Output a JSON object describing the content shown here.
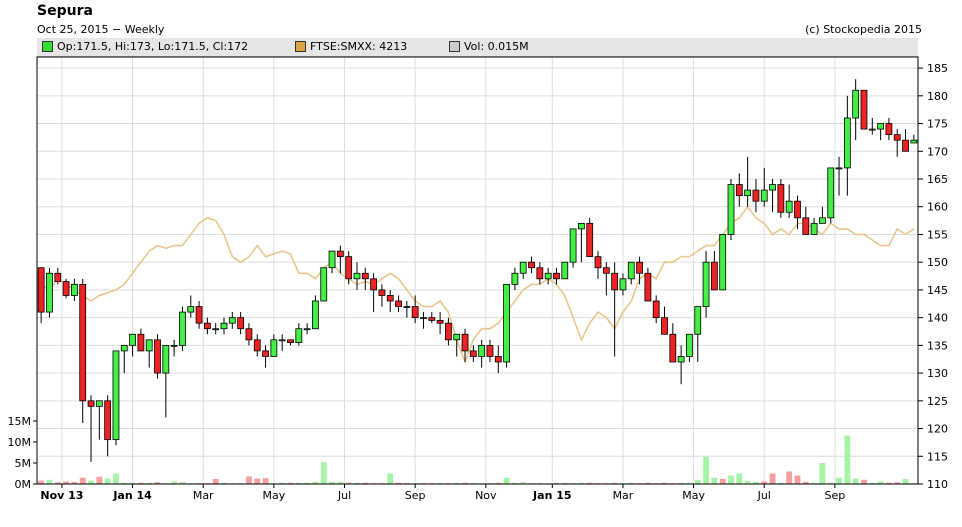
{
  "header": {
    "title": "Sepura",
    "subtitle": "Oct 25, 2015 − Weekly",
    "credit": "(c) Stockopedia 2015"
  },
  "legend": [
    {
      "text": "Op:171.5, Hi:173, Lo:171.5, Cl:172",
      "color": "#33dd33"
    },
    {
      "text": "FTSE:SMXX: 4213",
      "color": "#d9a441"
    },
    {
      "text": "Vol: 0.015M",
      "color": "#cccccc"
    }
  ],
  "colors": {
    "up": "#44ee44",
    "down": "#ee2222",
    "ftse": "#e8c68c",
    "vol_up": "#a6f5a6",
    "vol_down": "#f5a0a0",
    "grid": "#dddddd"
  },
  "chart_data": {
    "type": "candlestick",
    "title": "Sepura",
    "price_axis": {
      "side": "right",
      "ylim": [
        110,
        187
      ],
      "ticks": [
        110,
        115,
        120,
        125,
        130,
        135,
        140,
        145,
        150,
        155,
        160,
        165,
        170,
        175,
        180,
        185
      ]
    },
    "volume_axis": {
      "side": "left",
      "ylim": [
        0,
        20
      ],
      "unit": "M",
      "ticks": [
        {
          "v": 0,
          "label": "0M"
        },
        {
          "v": 5,
          "label": "5M"
        },
        {
          "v": 10,
          "label": "10M"
        },
        {
          "v": 15,
          "label": "15M"
        }
      ]
    },
    "x_labels": [
      {
        "i": 2.5,
        "label": "Nov 13",
        "bold": true
      },
      {
        "i": 11,
        "label": "Jan 14",
        "bold": true
      },
      {
        "i": 19.5,
        "label": "Mar",
        "bold": false
      },
      {
        "i": 28,
        "label": "May",
        "bold": false
      },
      {
        "i": 36.5,
        "label": "Jul",
        "bold": false
      },
      {
        "i": 45,
        "label": "Sep",
        "bold": false
      },
      {
        "i": 53.5,
        "label": "Nov",
        "bold": false
      },
      {
        "i": 61.5,
        "label": "Jan 15",
        "bold": true
      },
      {
        "i": 70,
        "label": "Mar",
        "bold": false
      },
      {
        "i": 78.5,
        "label": "May",
        "bold": false
      },
      {
        "i": 87,
        "label": "Jul",
        "bold": false
      },
      {
        "i": 95.5,
        "label": "Sep",
        "bold": false
      }
    ],
    "ohlc": [
      [
        149,
        149,
        139,
        141
      ],
      [
        141,
        149,
        140,
        148
      ],
      [
        148,
        149,
        146,
        146.5
      ],
      [
        146.5,
        147,
        143.5,
        144
      ],
      [
        144,
        147,
        143,
        146
      ],
      [
        146,
        147,
        121,
        125
      ],
      [
        125,
        126,
        114,
        124
      ],
      [
        124,
        125,
        118,
        125
      ],
      [
        125,
        126,
        115,
        118
      ],
      [
        118,
        134,
        117,
        134
      ],
      [
        134,
        135,
        130,
        135
      ],
      [
        135,
        137,
        133,
        137
      ],
      [
        137,
        138,
        134,
        134
      ],
      [
        134,
        136,
        131,
        136
      ],
      [
        136,
        137,
        129,
        130
      ],
      [
        130,
        135,
        122,
        135
      ],
      [
        135,
        136,
        133,
        135
      ],
      [
        135,
        142,
        134,
        141
      ],
      [
        141,
        144,
        140,
        142
      ],
      [
        142,
        143,
        138,
        139
      ],
      [
        139,
        140,
        137,
        138
      ],
      [
        138,
        139,
        137,
        138
      ],
      [
        138,
        140,
        137,
        139
      ],
      [
        139,
        141,
        138,
        140
      ],
      [
        140,
        141,
        137,
        138
      ],
      [
        138,
        139,
        135,
        136
      ],
      [
        136,
        137,
        133,
        134
      ],
      [
        134,
        135,
        131,
        133
      ],
      [
        133,
        137,
        133,
        136
      ],
      [
        136,
        137,
        134,
        136
      ],
      [
        136,
        136,
        135,
        135.5
      ],
      [
        135.5,
        139,
        135,
        138
      ],
      [
        138,
        139,
        137,
        138
      ],
      [
        138,
        144,
        138,
        143
      ],
      [
        143,
        148,
        143,
        149
      ],
      [
        149,
        150,
        148,
        152
      ],
      [
        152,
        153,
        148,
        151
      ],
      [
        151,
        152,
        146,
        147
      ],
      [
        147,
        150,
        145,
        148
      ],
      [
        148,
        149,
        145,
        147
      ],
      [
        147,
        148,
        141,
        145
      ],
      [
        145,
        146,
        142,
        144
      ],
      [
        144,
        145,
        141,
        143
      ],
      [
        143,
        144,
        141,
        142
      ],
      [
        142,
        143,
        140,
        142
      ],
      [
        142,
        144,
        139,
        140
      ],
      [
        140,
        141,
        138,
        140
      ],
      [
        140,
        141,
        139,
        139.5
      ],
      [
        139.5,
        141,
        137,
        139
      ],
      [
        139,
        140,
        135,
        136
      ],
      [
        136,
        137,
        133,
        137
      ],
      [
        137,
        138,
        132,
        134
      ],
      [
        134,
        135,
        132,
        133
      ],
      [
        133,
        136,
        131,
        135
      ],
      [
        135,
        136,
        132,
        133
      ],
      [
        133,
        135,
        130,
        132
      ],
      [
        132,
        146,
        131,
        146
      ],
      [
        146,
        149,
        145,
        148
      ],
      [
        148,
        150,
        147,
        150
      ],
      [
        150,
        151,
        148,
        149
      ],
      [
        149,
        150,
        146,
        147
      ],
      [
        147,
        149,
        146,
        148
      ],
      [
        148,
        149,
        146,
        147
      ],
      [
        147,
        150,
        147,
        150
      ],
      [
        150,
        156,
        149,
        156
      ],
      [
        156,
        157,
        150,
        157
      ],
      [
        157,
        158,
        151,
        151
      ],
      [
        151,
        152,
        147,
        149
      ],
      [
        149,
        150,
        144,
        148
      ],
      [
        148,
        150,
        133,
        145
      ],
      [
        145,
        148,
        144,
        147
      ],
      [
        147,
        149,
        146,
        150
      ],
      [
        150,
        151,
        146,
        148
      ],
      [
        148,
        149,
        143,
        143
      ],
      [
        143,
        144,
        139,
        140
      ],
      [
        140,
        142,
        137,
        137
      ],
      [
        137,
        139,
        134,
        132
      ],
      [
        132,
        135,
        128,
        133
      ],
      [
        133,
        137,
        132,
        137
      ],
      [
        137,
        142,
        132,
        142
      ],
      [
        142,
        152,
        140,
        150
      ],
      [
        150,
        152,
        146,
        145
      ],
      [
        145,
        153,
        145,
        155
      ],
      [
        155,
        165,
        154,
        164
      ],
      [
        164,
        166,
        160,
        162
      ],
      [
        162,
        169,
        160,
        163
      ],
      [
        163,
        165,
        159,
        161
      ],
      [
        161,
        167,
        160,
        163
      ],
      [
        163,
        165,
        159,
        164
      ],
      [
        164,
        165,
        158,
        159
      ],
      [
        159,
        164,
        158,
        161
      ],
      [
        161,
        162,
        156,
        158
      ],
      [
        158,
        160,
        155,
        155
      ],
      [
        155,
        158,
        155,
        157
      ],
      [
        157,
        160,
        157,
        158
      ],
      [
        158,
        167,
        157,
        167
      ],
      [
        167,
        169,
        162,
        167
      ],
      [
        167,
        180,
        162,
        176
      ],
      [
        176,
        183,
        172,
        181
      ],
      [
        181,
        181,
        174,
        174
      ],
      [
        174,
        176,
        173,
        174
      ],
      [
        174,
        175,
        172,
        175
      ],
      [
        175,
        176,
        172,
        173
      ],
      [
        173,
        174,
        169,
        172
      ],
      [
        172,
        174,
        170,
        170
      ],
      [
        171.5,
        173,
        171.5,
        172
      ]
    ],
    "volume_m": [
      [
        0.8,
        0
      ],
      [
        1.0,
        1
      ],
      [
        0.4,
        0
      ],
      [
        0.6,
        0
      ],
      [
        0.5,
        0
      ],
      [
        1.5,
        0
      ],
      [
        0.8,
        1
      ],
      [
        1.7,
        0
      ],
      [
        1.3,
        1
      ],
      [
        2.5,
        1
      ],
      [
        0.3,
        1
      ],
      [
        0.3,
        1
      ],
      [
        0.3,
        0
      ],
      [
        0.3,
        1
      ],
      [
        0.4,
        0
      ],
      [
        0.2,
        1
      ],
      [
        0.6,
        1
      ],
      [
        0.5,
        1
      ],
      [
        0.2,
        1
      ],
      [
        0.2,
        0
      ],
      [
        0.2,
        0
      ],
      [
        1.2,
        0
      ],
      [
        0.3,
        1
      ],
      [
        0.2,
        1
      ],
      [
        0.2,
        1
      ],
      [
        1.8,
        0
      ],
      [
        1.3,
        0
      ],
      [
        1.4,
        0
      ],
      [
        0.2,
        1
      ],
      [
        0.3,
        1
      ],
      [
        0.3,
        0
      ],
      [
        0.3,
        1
      ],
      [
        0.3,
        1
      ],
      [
        0.5,
        1
      ],
      [
        5.2,
        1
      ],
      [
        0.5,
        1
      ],
      [
        0.5,
        1
      ],
      [
        0.3,
        0
      ],
      [
        0.3,
        1
      ],
      [
        0.3,
        0
      ],
      [
        0.2,
        0
      ],
      [
        0.2,
        0
      ],
      [
        2.5,
        1
      ],
      [
        0.3,
        0
      ],
      [
        0.2,
        0
      ],
      [
        0.2,
        1
      ],
      [
        0.2,
        0
      ],
      [
        0.2,
        0
      ],
      [
        0.2,
        1
      ],
      [
        0.2,
        0
      ],
      [
        0.3,
        1
      ],
      [
        0.3,
        0
      ],
      [
        0.2,
        0
      ],
      [
        0.2,
        1
      ],
      [
        0.2,
        0
      ],
      [
        0.3,
        0
      ],
      [
        1.5,
        1
      ],
      [
        0.3,
        1
      ],
      [
        0.4,
        1
      ],
      [
        0.2,
        1
      ],
      [
        0.2,
        0
      ],
      [
        0.2,
        1
      ],
      [
        0.3,
        0
      ],
      [
        0.3,
        1
      ],
      [
        0.2,
        1
      ],
      [
        0.3,
        1
      ],
      [
        0.3,
        0
      ],
      [
        0.2,
        0
      ],
      [
        0.2,
        0
      ],
      [
        0.3,
        0
      ],
      [
        0.2,
        1
      ],
      [
        0.3,
        1
      ],
      [
        0.2,
        0
      ],
      [
        0.3,
        0
      ],
      [
        0.2,
        0
      ],
      [
        0.3,
        0
      ],
      [
        0.2,
        0
      ],
      [
        0.3,
        1
      ],
      [
        0.3,
        1
      ],
      [
        1.0,
        1
      ],
      [
        6.5,
        1
      ],
      [
        1.5,
        1
      ],
      [
        1.2,
        0
      ],
      [
        2.0,
        1
      ],
      [
        2.5,
        1
      ],
      [
        0.7,
        1
      ],
      [
        0.5,
        1
      ],
      [
        0.6,
        0
      ],
      [
        2.5,
        0
      ],
      [
        0.3,
        1
      ],
      [
        3.0,
        0
      ],
      [
        2.0,
        0
      ],
      [
        0.5,
        0
      ],
      [
        0.3,
        1
      ],
      [
        5.0,
        1
      ],
      [
        0.3,
        1
      ],
      [
        1.5,
        1
      ],
      [
        11.5,
        1
      ],
      [
        1.3,
        1
      ],
      [
        1.0,
        0
      ],
      [
        0.3,
        1
      ],
      [
        0.6,
        1
      ],
      [
        0.3,
        0
      ],
      [
        0.4,
        0
      ],
      [
        1.2,
        1
      ],
      [
        0.2,
        1
      ]
    ],
    "ftse": [
      146,
      145,
      147,
      146,
      145,
      144,
      143,
      144,
      144.5,
      145,
      146,
      148,
      150,
      152,
      153,
      152.5,
      153,
      153,
      155,
      157,
      158,
      157.5,
      155,
      151,
      150,
      151,
      153,
      151,
      151.5,
      152,
      151.5,
      148,
      148,
      147,
      149,
      150,
      148,
      147,
      146,
      146.5,
      146,
      147,
      148,
      147,
      145,
      143,
      142,
      142,
      143,
      141,
      136,
      132,
      136,
      138,
      138,
      139,
      141,
      143,
      145,
      146,
      146,
      147,
      146,
      144,
      140,
      136,
      139,
      141,
      140,
      138,
      141,
      143,
      147,
      148,
      147,
      150,
      150,
      151,
      151,
      152,
      153,
      153,
      155,
      157,
      158,
      160,
      158,
      157,
      155,
      156,
      155,
      157,
      157,
      156,
      155,
      157,
      156,
      156,
      155,
      155,
      154,
      153,
      153,
      156,
      155,
      156
    ]
  }
}
